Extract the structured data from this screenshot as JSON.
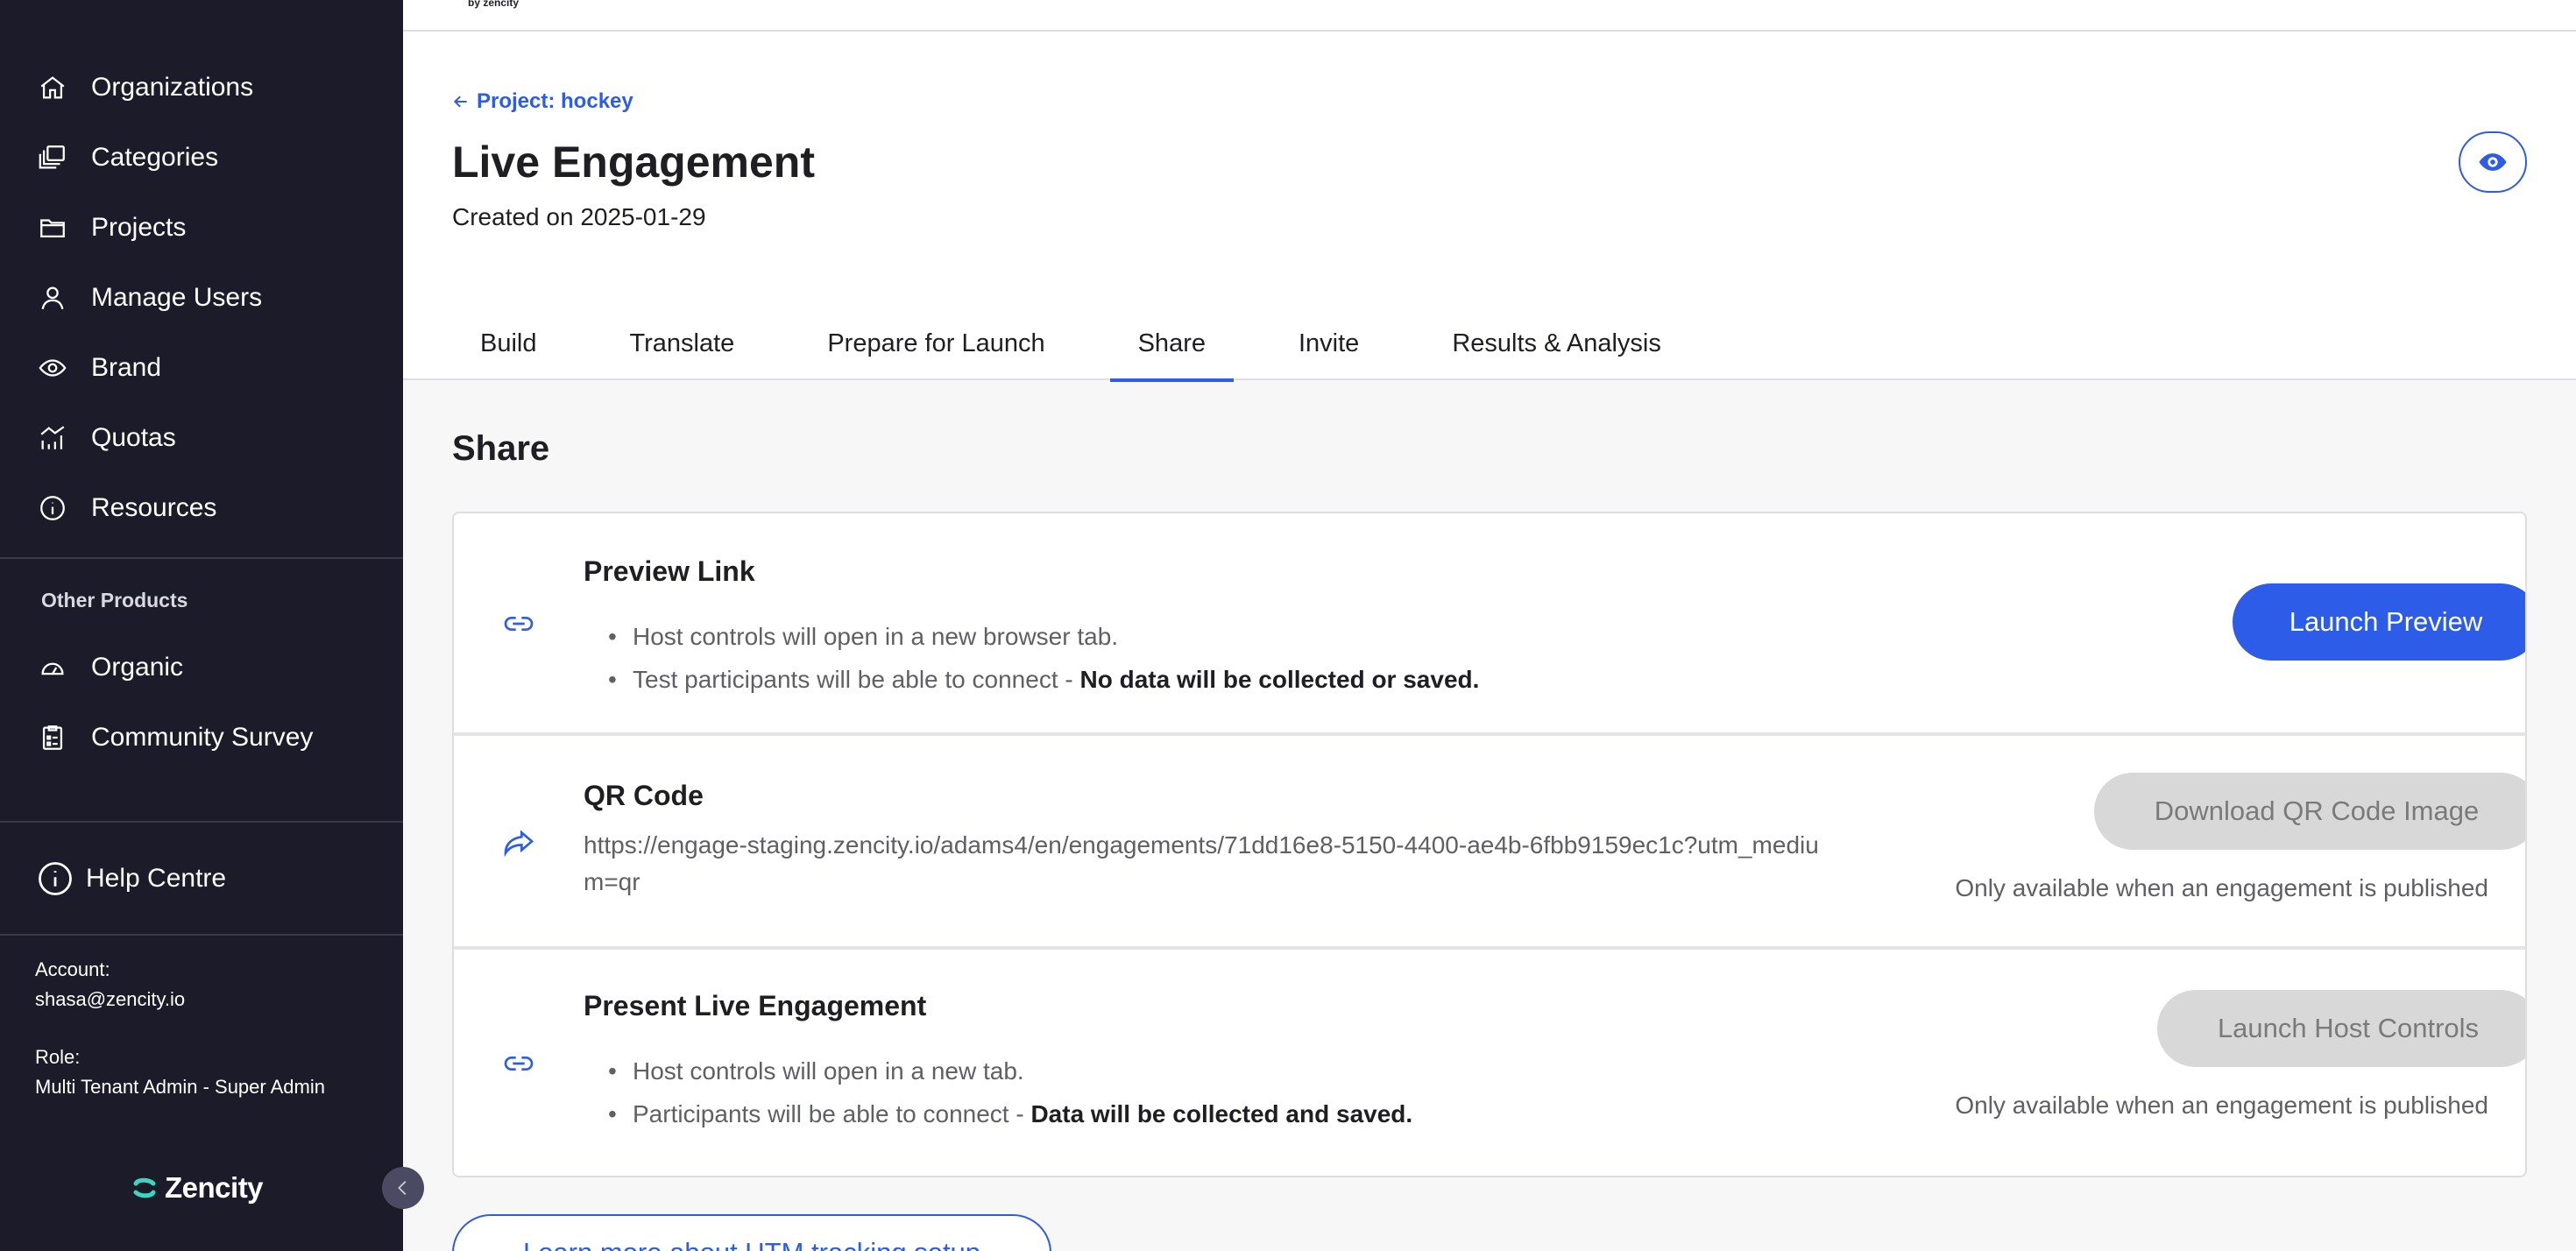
{
  "sidebar": {
    "nav": [
      {
        "label": "Organizations",
        "icon": "home-icon"
      },
      {
        "label": "Categories",
        "icon": "categories-icon"
      },
      {
        "label": "Projects",
        "icon": "folder-icon"
      },
      {
        "label": "Manage Users",
        "icon": "user-icon"
      },
      {
        "label": "Brand",
        "icon": "eye-icon"
      },
      {
        "label": "Quotas",
        "icon": "chart-icon"
      },
      {
        "label": "Resources",
        "icon": "info-icon"
      }
    ],
    "other_products_label": "Other Products",
    "other_products": [
      {
        "label": "Organic",
        "icon": "gauge-icon"
      },
      {
        "label": "Community Survey",
        "icon": "survey-icon"
      }
    ],
    "help": {
      "label": "Help Centre",
      "icon": "info-circle-icon"
    },
    "account": {
      "label": "Account:",
      "value": "shasa@zencity.io"
    },
    "role": {
      "label": "Role:",
      "value": "Multi Tenant Admin - Super Admin"
    },
    "logo_text": "Zencity"
  },
  "header": {
    "by_text": "by zencity",
    "back_link": "Project: hockey",
    "title": "Live Engagement",
    "created": "Created on 2025-01-29",
    "tabs": [
      {
        "label": "Build"
      },
      {
        "label": "Translate"
      },
      {
        "label": "Prepare for Launch"
      },
      {
        "label": "Share"
      },
      {
        "label": "Invite"
      },
      {
        "label": "Results & Analysis"
      }
    ],
    "active_tab": "Share"
  },
  "share": {
    "section_title": "Share",
    "preview": {
      "title": "Preview Link",
      "bullet1": "Host controls will open in a new browser tab.",
      "bullet2_text": "Test participants will be able to connect - ",
      "bullet2_bold": "No data will be collected or saved.",
      "button": "Launch Preview"
    },
    "qr": {
      "title": "QR Code",
      "url": "https://engage-staging.zencity.io/adams4/en/engagements/71dd16e8-5150-4400-ae4b-6fbb9159ec1c?utm_medium=qr",
      "button": "Download QR Code Image",
      "note": "Only available when an engagement is published"
    },
    "present": {
      "title": "Present Live Engagement",
      "bullet1": "Host controls will open in a new tab.",
      "bullet2_text": "Participants will be able to connect - ",
      "bullet2_bold": "Data will be collected and saved.",
      "button": "Launch Host Controls",
      "note": "Only available when an engagement is published"
    },
    "utm_button": "Learn more about UTM tracking setup"
  },
  "colors": {
    "accent": "#2d5ce8",
    "sidebar_bg": "#1c1b29",
    "logo_accent": "#3ad6c0"
  }
}
